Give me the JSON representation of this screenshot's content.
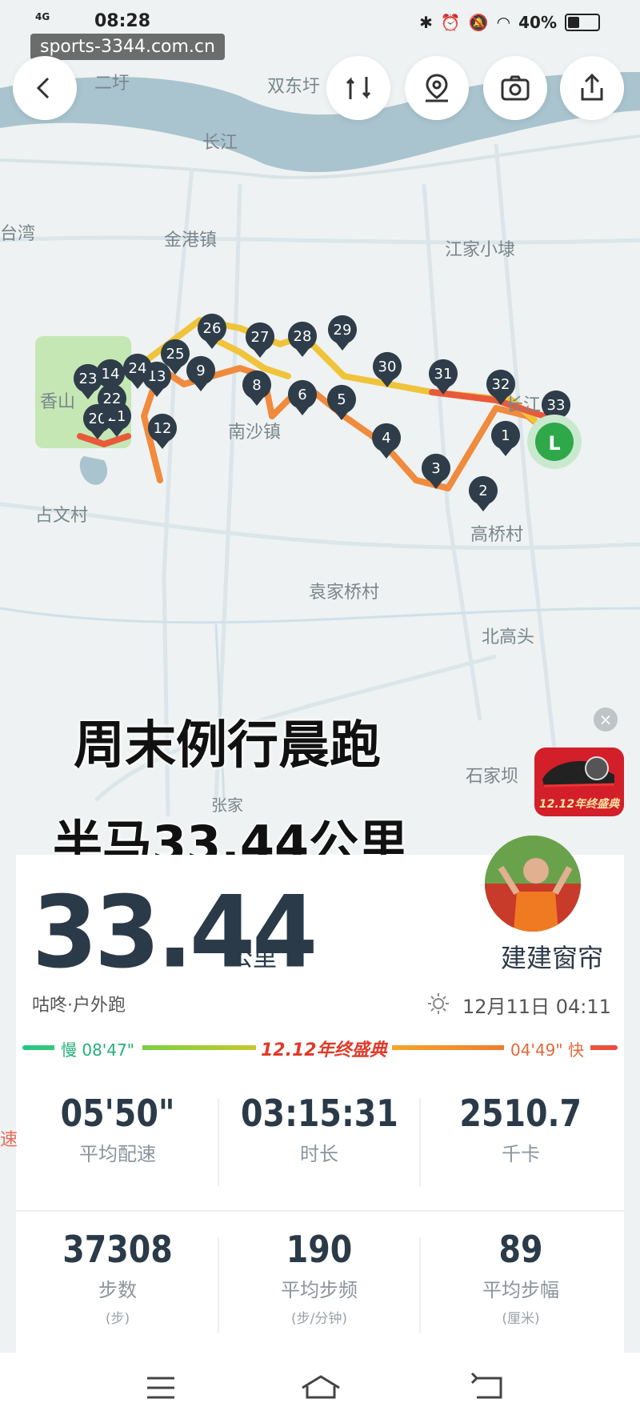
{
  "status_bar": {
    "network": "4G",
    "time": "08:28",
    "battery": "40%"
  },
  "watermark": "sports-3344.com.cn",
  "map": {
    "place_labels": [
      "二圩",
      "双东圩",
      "长江",
      "台湾",
      "金港镇",
      "江家小埭",
      "香山",
      "南沙镇",
      "长江",
      "占文村",
      "高桥村",
      "袁家桥村",
      "北高头",
      "石家坝",
      "张家"
    ],
    "km_markers": [
      "1",
      "2",
      "3",
      "4",
      "5",
      "6",
      "8",
      "9",
      "12",
      "13",
      "14",
      "20",
      "21",
      "22",
      "23",
      "24",
      "25",
      "26",
      "27",
      "28",
      "29",
      "30",
      "31",
      "32",
      "33"
    ],
    "finish_marker": "L",
    "colors": {
      "route_slow": "#f0c43a",
      "route_mid": "#f08a3c",
      "route_fast": "#e85a3a",
      "marker": "#2e3d49",
      "finish": "#2fa84a"
    }
  },
  "headline": {
    "line1": "周末例行晨跑",
    "line2": "半马33.44公里"
  },
  "promo": {
    "label": "12.12年终盛典"
  },
  "summary": {
    "distance": "33.44",
    "distance_unit": "公里",
    "username": "建建窗帘",
    "activity": "咕咚·户外跑",
    "datetime": "12月11日 04:11",
    "pace_slow": "慢 08'47\"",
    "pace_fast": "04'49\" 快",
    "pace_promo": "12.12年终盛典"
  },
  "stats": [
    {
      "value": "05'50\"",
      "label": "平均配速",
      "sub": ""
    },
    {
      "value": "03:15:31",
      "label": "时长",
      "sub": ""
    },
    {
      "value": "2510.7",
      "label": "千卡",
      "sub": ""
    },
    {
      "value": "37308",
      "label": "步数",
      "sub": "(步)"
    },
    {
      "value": "190",
      "label": "平均步频",
      "sub": "(步/分钟)"
    },
    {
      "value": "89",
      "label": "平均步幅",
      "sub": "(厘米)"
    }
  ],
  "side_label": "速"
}
